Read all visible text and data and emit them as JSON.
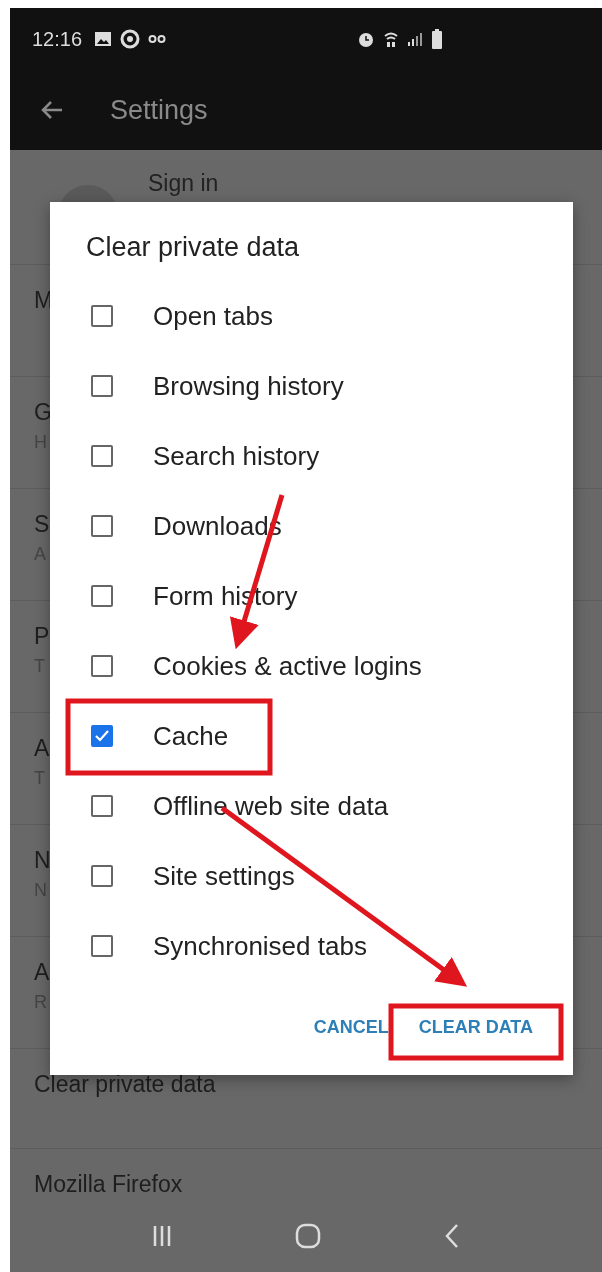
{
  "status_bar": {
    "time": "12:16"
  },
  "toolbar": {
    "title": "Settings"
  },
  "settings_list": {
    "sign_in": "Sign in",
    "items": [
      {
        "title": "M"
      },
      {
        "title": "G",
        "subtitle": "H"
      },
      {
        "title": "S",
        "subtitle": "A"
      },
      {
        "title": "P",
        "subtitle": "T"
      },
      {
        "title": "A",
        "subtitle": "T"
      },
      {
        "title": "N",
        "subtitle": "N"
      },
      {
        "title": "A",
        "subtitle": "R"
      },
      {
        "title": "Clear private data"
      },
      {
        "title": "Mozilla Firefox"
      }
    ]
  },
  "dialog": {
    "title": "Clear private data",
    "options": [
      {
        "label": "Open tabs",
        "checked": false
      },
      {
        "label": "Browsing history",
        "checked": false
      },
      {
        "label": "Search history",
        "checked": false
      },
      {
        "label": "Downloads",
        "checked": false
      },
      {
        "label": "Form history",
        "checked": false
      },
      {
        "label": "Cookies & active logins",
        "checked": false
      },
      {
        "label": "Cache",
        "checked": true
      },
      {
        "label": "Offline web site data",
        "checked": false
      },
      {
        "label": "Site settings",
        "checked": false
      },
      {
        "label": "Synchronised tabs",
        "checked": false
      }
    ],
    "buttons": [
      {
        "label": "CANCEL",
        "highlighted": false
      },
      {
        "label": "CLEAR DATA",
        "highlighted": true
      }
    ]
  }
}
